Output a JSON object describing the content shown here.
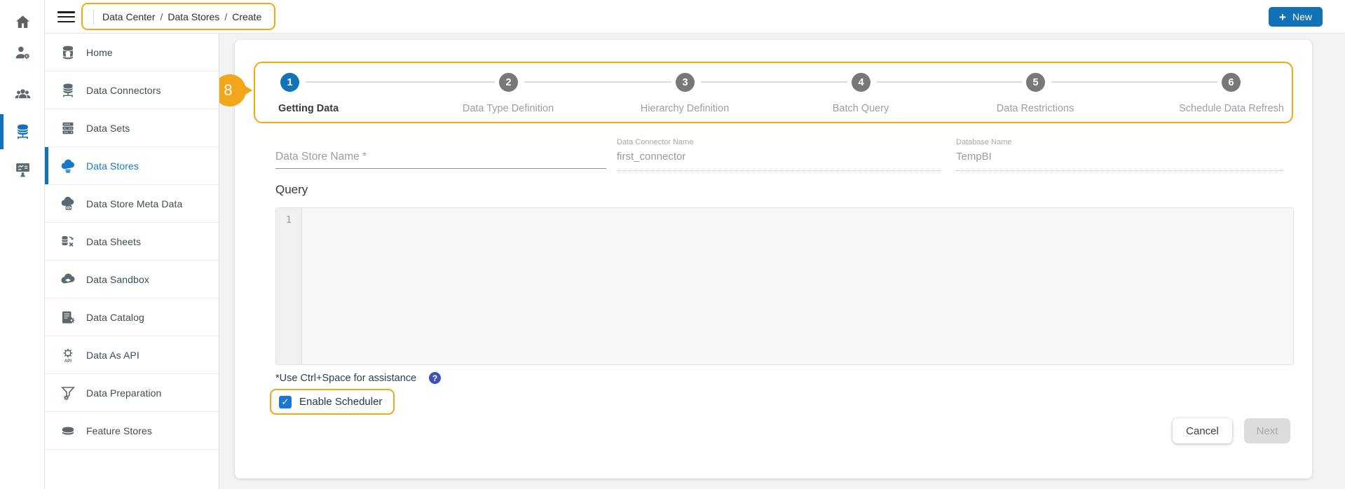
{
  "colors": {
    "annotation_orange": "#F2A71B",
    "primary_blue": "#1272B8",
    "active_link_blue": "#1779C4",
    "checkbox_blue": "#1B78D2",
    "help_icon_bg": "#3F51B5",
    "step_inactive_gray": "#787878"
  },
  "topbar": {
    "menu_icon": "hamburger-menu-icon",
    "breadcrumb": {
      "items": {
        "0": "Data Center",
        "1": "Data Stores",
        "2": "Create"
      },
      "separator": "/"
    },
    "new_button": {
      "icon": "+",
      "label": "New"
    }
  },
  "rail": {
    "icons": [
      "home-icon",
      "user-settings-icon",
      "users-icon",
      "data-server-icon",
      "dashboard-user-icon"
    ],
    "active": "data-server-icon"
  },
  "sidebar": {
    "items": {
      "0": {
        "label": "Home",
        "icon": "database-home-icon"
      },
      "1": {
        "label": "Data Connectors",
        "icon": "database-network-icon"
      },
      "2": {
        "label": "Data Sets",
        "icon": "server-stack-icon"
      },
      "3": {
        "label": "Data Stores",
        "icon": "cloud-database-icon",
        "active": true
      },
      "4": {
        "label": "Data Store Meta Data",
        "icon": "cloud-code-icon"
      },
      "5": {
        "label": "Data Sheets",
        "icon": "sheet-sync-icon"
      },
      "6": {
        "label": "Data Sandbox",
        "icon": "cloud-icon"
      },
      "7": {
        "label": "Data Catalog",
        "icon": "catalog-gear-icon"
      },
      "8": {
        "label": "Data As API",
        "icon": "api-gear-icon"
      },
      "9": {
        "label": "Data Preparation",
        "icon": "funnel-gear-icon"
      },
      "10": {
        "label": "Feature Stores",
        "icon": "feature-database-icon"
      }
    }
  },
  "annotations": {
    "badge": "8"
  },
  "stepper": {
    "steps": {
      "0": {
        "num": "1",
        "label": "Getting Data",
        "active": true
      },
      "1": {
        "num": "2",
        "label": "Data Type Definition"
      },
      "2": {
        "num": "3",
        "label": "Hierarchy Definition"
      },
      "3": {
        "num": "4",
        "label": "Batch Query"
      },
      "4": {
        "num": "5",
        "label": "Data Restrictions"
      },
      "5": {
        "num": "6",
        "label": "Schedule Data Refresh"
      }
    }
  },
  "form": {
    "data_store_name": {
      "placeholder": "Data Store Name *",
      "value": ""
    },
    "data_connector": {
      "label": "Data Connector Name",
      "value": "first_connector"
    },
    "database": {
      "label": "Database Name",
      "value": "TempBI"
    }
  },
  "query": {
    "heading": "Query",
    "line_number": "1",
    "content": ""
  },
  "footer": {
    "hint": "*Use Ctrl+Space for assistance",
    "help_glyph": "?",
    "scheduler": {
      "label": "Enable Scheduler",
      "checked": true,
      "check_glyph": "✓"
    },
    "cancel_label": "Cancel",
    "next_label": "Next",
    "next_disabled": true
  }
}
